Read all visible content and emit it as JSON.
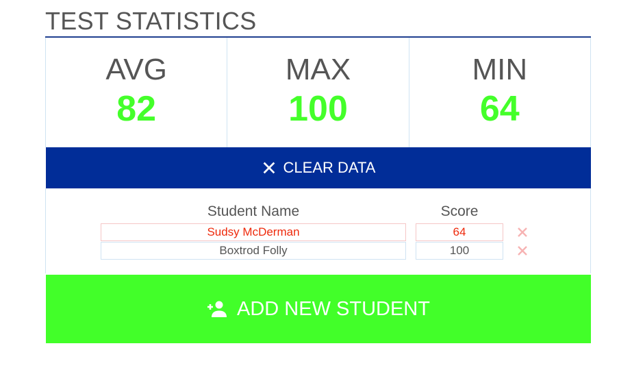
{
  "page": {
    "title": "TEST STATISTICS"
  },
  "stats": {
    "avg": {
      "label": "AVG",
      "value": "82"
    },
    "max": {
      "label": "MAX",
      "value": "100"
    },
    "min": {
      "label": "MIN",
      "value": "64"
    }
  },
  "clear_button": {
    "label": "CLEAR DATA",
    "icon": "close-icon"
  },
  "table": {
    "headers": {
      "name": "Student Name",
      "score": "Score"
    },
    "rows": [
      {
        "name": "Sudsy McDerman",
        "score": "64",
        "status": "below-passing"
      },
      {
        "name": "Boxtrod Folly",
        "score": "100",
        "status": "passing"
      }
    ],
    "remove_icon": "close-icon"
  },
  "add_button": {
    "label": "ADD NEW STUDENT",
    "icon": "person-add-icon"
  },
  "colors": {
    "title_text": "#555555",
    "accent_rule": "#1f3f8f",
    "stat_value": "#44ff2a",
    "clear_button_bg": "#012d98",
    "add_button_bg": "#42ff29",
    "invalid_text": "#ee2a0c",
    "remove_icon": "#f7b3b3"
  }
}
